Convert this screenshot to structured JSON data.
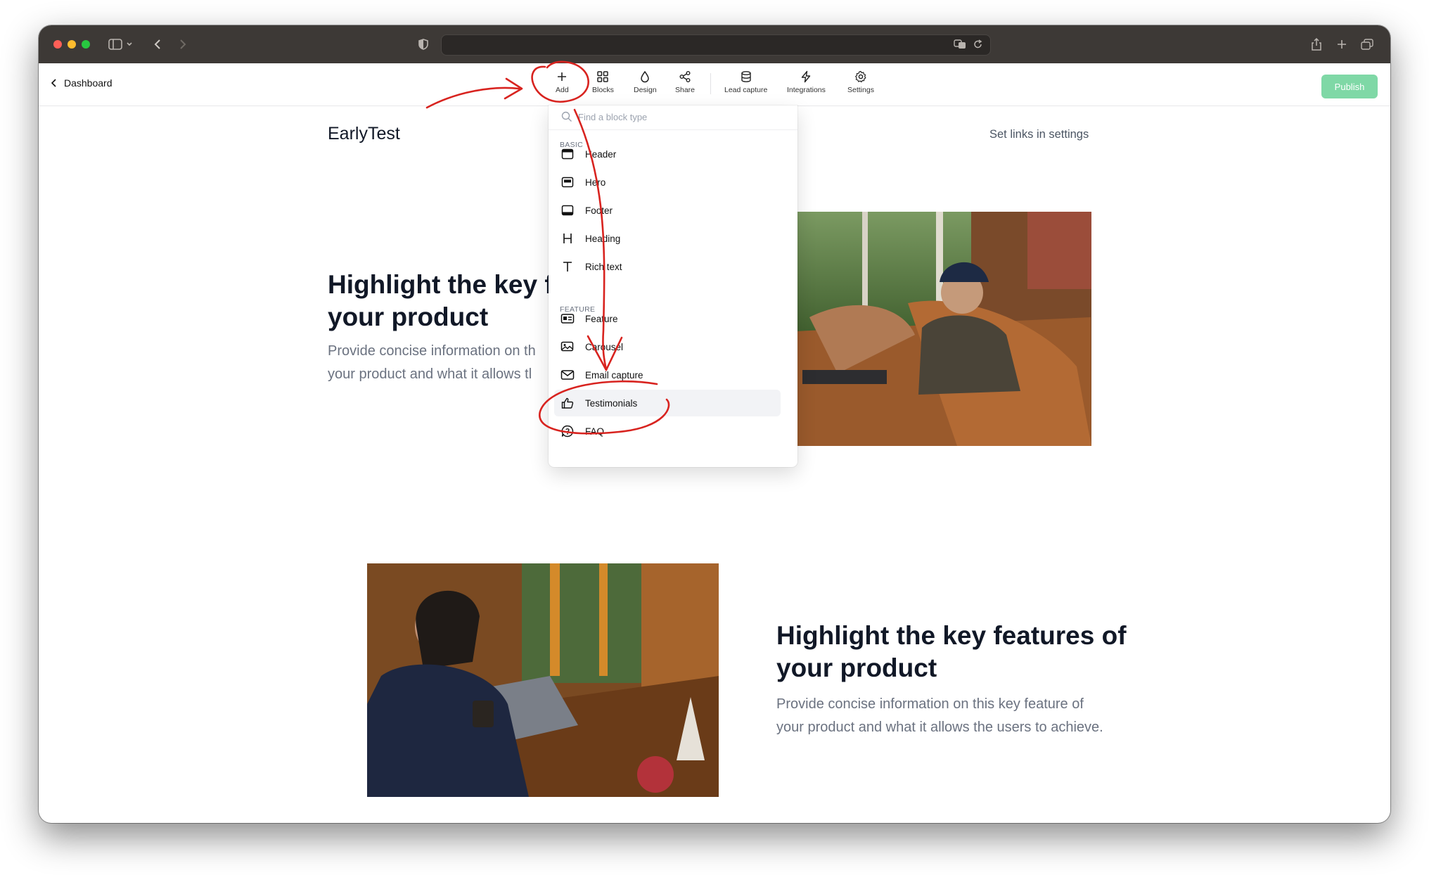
{
  "app": {
    "back_label": "Dashboard",
    "publish_label": "Publish"
  },
  "toolbar": {
    "items": [
      {
        "label": "Add",
        "icon": "plus-icon"
      },
      {
        "label": "Blocks",
        "icon": "grid-icon"
      },
      {
        "label": "Design",
        "icon": "droplet-icon"
      },
      {
        "label": "Share",
        "icon": "share-icon"
      },
      {
        "label": "Lead capture",
        "icon": "database-icon"
      },
      {
        "label": "Integrations",
        "icon": "bolt-icon"
      },
      {
        "label": "Settings",
        "icon": "gear-icon"
      }
    ]
  },
  "page": {
    "brand": "EarlyTest",
    "set_links": "Set links in settings",
    "feature1": {
      "heading_line1": "Highlight the key f",
      "heading_line2": "your product",
      "para_line1": "Provide concise information on th",
      "para_line2": "your product and what it allows tl"
    },
    "feature2": {
      "heading_line1": "Highlight the key features of",
      "heading_line2": "your product",
      "para_line1": "Provide concise information on this key feature of",
      "para_line2": "your product and what it allows the users to achieve."
    }
  },
  "block_menu": {
    "search_placeholder": "Find a block type",
    "sections": [
      {
        "title": "BASIC",
        "items": [
          {
            "label": "Header",
            "icon": "header-block-icon"
          },
          {
            "label": "Hero",
            "icon": "hero-block-icon"
          },
          {
            "label": "Footer",
            "icon": "footer-block-icon"
          },
          {
            "label": "Heading",
            "icon": "heading-h-icon"
          },
          {
            "label": "Rich text",
            "icon": "text-t-icon"
          }
        ]
      },
      {
        "title": "FEATURE",
        "items": [
          {
            "label": "Feature",
            "icon": "feature-card-icon"
          },
          {
            "label": "Carousel",
            "icon": "image-carousel-icon"
          },
          {
            "label": "Email capture",
            "icon": "mail-icon"
          },
          {
            "label": "Testimonials",
            "icon": "thumbs-up-icon",
            "highlighted": true
          },
          {
            "label": "FAQ",
            "icon": "question-bubble-icon"
          }
        ]
      }
    ]
  },
  "colors": {
    "chrome": "#3d3936",
    "publish_bg": "#7fd8a6",
    "annotation": "#d8231f",
    "heading": "#111827",
    "body_text": "#6b7280"
  }
}
